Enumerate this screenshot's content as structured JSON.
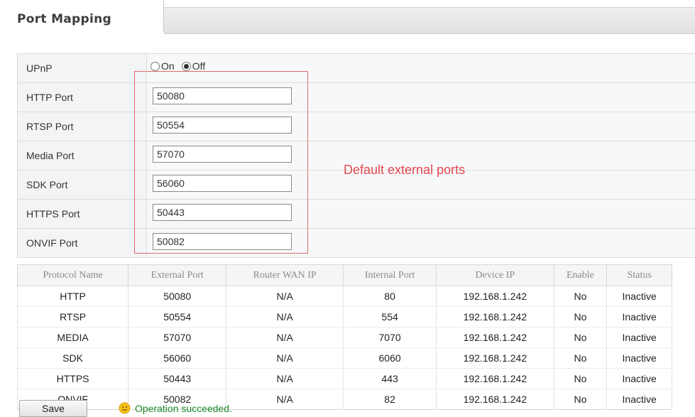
{
  "tab": {
    "title": "Port Mapping"
  },
  "form": {
    "upnp": {
      "label": "UPnP",
      "options": [
        {
          "label": "On",
          "checked": false
        },
        {
          "label": "Off",
          "checked": true
        }
      ]
    },
    "fields": [
      {
        "label": "HTTP Port",
        "value": "50080"
      },
      {
        "label": "RTSP Port",
        "value": "50554"
      },
      {
        "label": "Media Port",
        "value": "57070"
      },
      {
        "label": "SDK Port",
        "value": "56060"
      },
      {
        "label": "HTTPS Port",
        "value": "50443"
      },
      {
        "label": "ONVIF Port",
        "value": "50082"
      }
    ]
  },
  "annotation": {
    "text": "Default external ports",
    "color": "#e0484f"
  },
  "table": {
    "columns": [
      "Protocol Name",
      "External Port",
      "Router WAN IP",
      "Internal Port",
      "Device IP",
      "Enable",
      "Status"
    ],
    "rows": [
      [
        "HTTP",
        "50080",
        "N/A",
        "80",
        "192.168.1.242",
        "No",
        "Inactive"
      ],
      [
        "RTSP",
        "50554",
        "N/A",
        "554",
        "192.168.1.242",
        "No",
        "Inactive"
      ],
      [
        "MEDIA",
        "57070",
        "N/A",
        "7070",
        "192.168.1.242",
        "No",
        "Inactive"
      ],
      [
        "SDK",
        "56060",
        "N/A",
        "6060",
        "192.168.1.242",
        "No",
        "Inactive"
      ],
      [
        "HTTPS",
        "50443",
        "N/A",
        "443",
        "192.168.1.242",
        "No",
        "Inactive"
      ],
      [
        "ONVIF",
        "50082",
        "N/A",
        "82",
        "192.168.1.242",
        "No",
        "Inactive"
      ]
    ]
  },
  "footer": {
    "save_label": "Save",
    "status_text": "Operation succeeded.",
    "status_icon": "smiley-icon",
    "status_color": "#1a8a2a"
  }
}
